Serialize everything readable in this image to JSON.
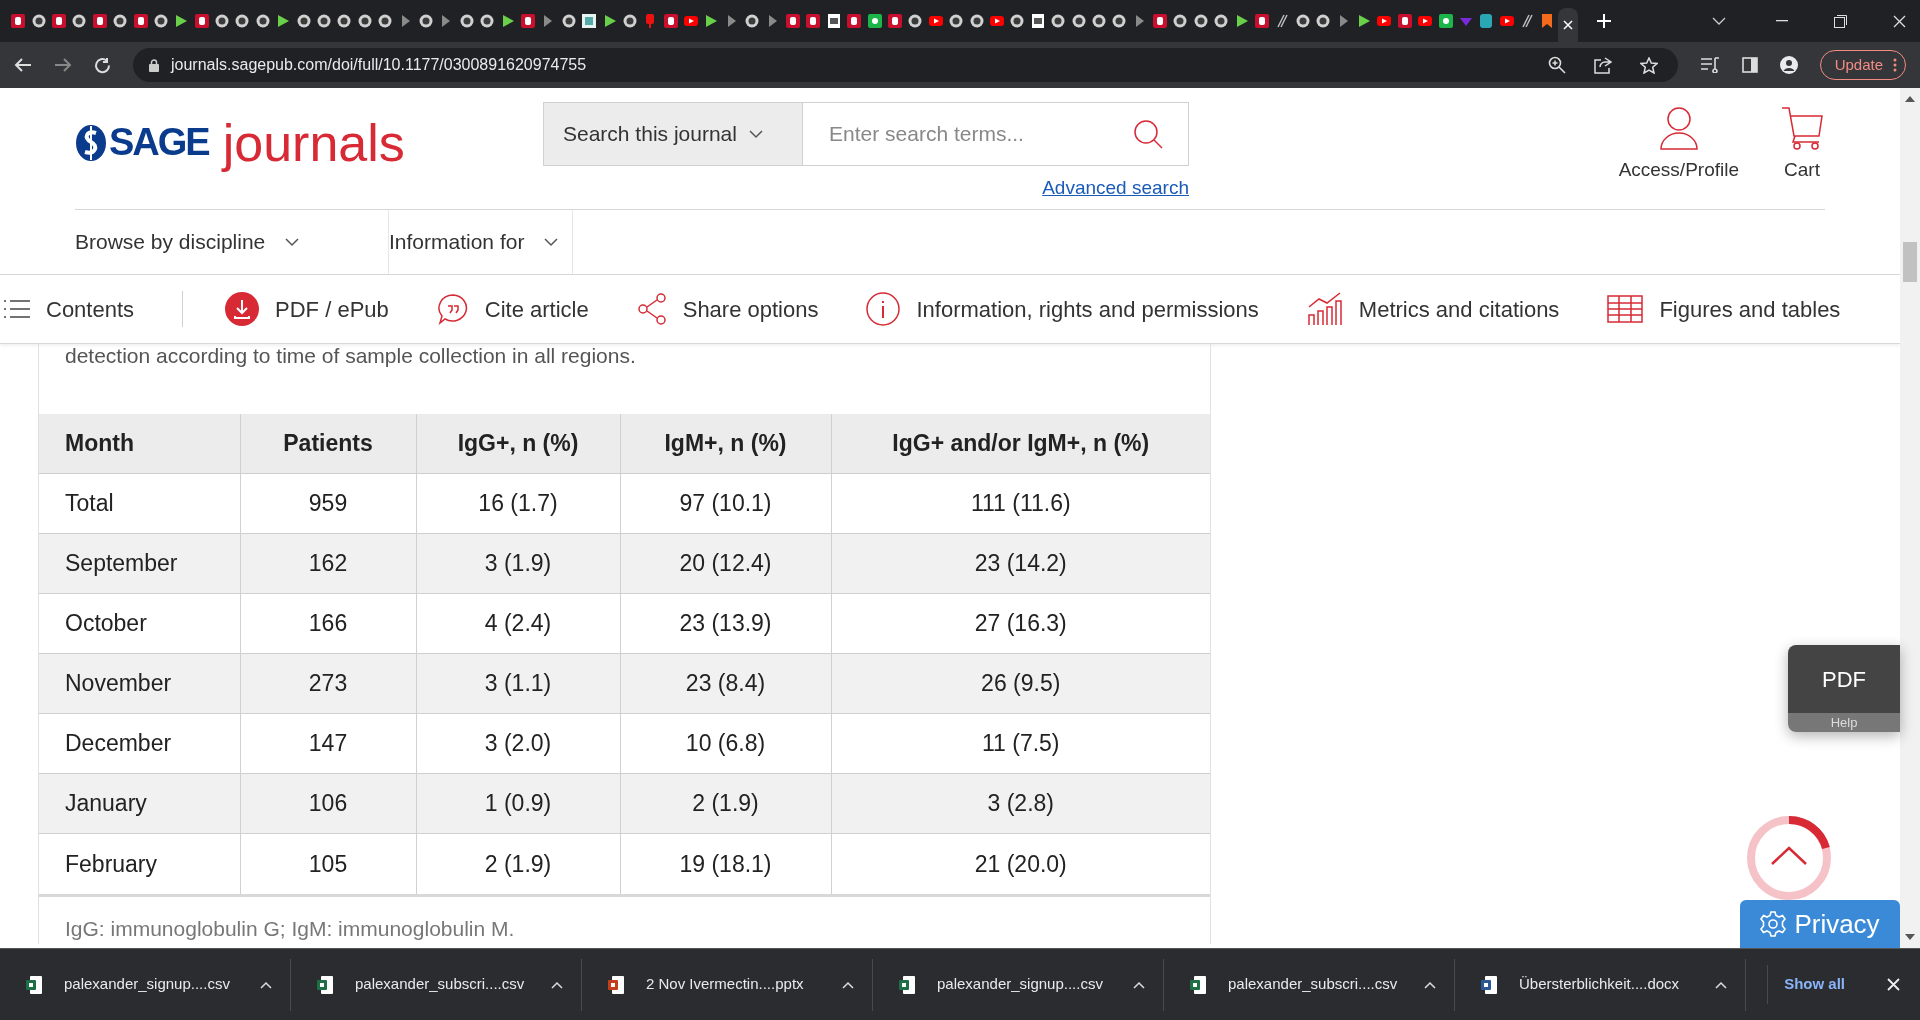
{
  "browser": {
    "tabs": [
      {
        "kind": "b",
        "selected": false
      },
      {
        "kind": "circle",
        "selected": false
      },
      {
        "kind": "b",
        "selected": false
      },
      {
        "kind": "circle",
        "selected": false
      },
      {
        "kind": "b",
        "selected": false
      },
      {
        "kind": "circle",
        "selected": false
      },
      {
        "kind": "b",
        "selected": false
      },
      {
        "kind": "circle",
        "selected": false
      },
      {
        "kind": "play",
        "selected": false
      },
      {
        "kind": "b",
        "selected": false
      },
      {
        "kind": "circle",
        "selected": false
      },
      {
        "kind": "circle",
        "selected": false
      },
      {
        "kind": "circle",
        "selected": false
      },
      {
        "kind": "play",
        "selected": false
      },
      {
        "kind": "circle",
        "selected": false
      },
      {
        "kind": "circle",
        "selected": false
      },
      {
        "kind": "circle",
        "selected": false
      },
      {
        "kind": "circle",
        "selected": false
      },
      {
        "kind": "circle",
        "selected": false
      },
      {
        "kind": "arrow",
        "selected": false
      },
      {
        "kind": "circle",
        "selected": false
      },
      {
        "kind": "arrow",
        "selected": false
      },
      {
        "kind": "circle",
        "selected": false
      },
      {
        "kind": "circle",
        "selected": false
      },
      {
        "kind": "play",
        "selected": false
      },
      {
        "kind": "b",
        "selected": false
      },
      {
        "kind": "arrow",
        "selected": false
      },
      {
        "kind": "circle",
        "selected": false
      },
      {
        "kind": "grid",
        "selected": false
      },
      {
        "kind": "play",
        "selected": false
      },
      {
        "kind": "circle",
        "selected": false
      },
      {
        "kind": "pin",
        "selected": false
      },
      {
        "kind": "b",
        "selected": false
      },
      {
        "kind": "yt",
        "selected": false
      },
      {
        "kind": "play",
        "selected": false
      },
      {
        "kind": "arrow",
        "selected": false
      },
      {
        "kind": "circle",
        "selected": false
      },
      {
        "kind": "arrow",
        "selected": false
      },
      {
        "kind": "b",
        "selected": false
      },
      {
        "kind": "b",
        "selected": false
      },
      {
        "kind": "doc",
        "selected": false
      },
      {
        "kind": "b",
        "selected": false
      },
      {
        "kind": "g",
        "selected": false
      },
      {
        "kind": "b",
        "selected": false
      },
      {
        "kind": "circle",
        "selected": false
      },
      {
        "kind": "yt",
        "selected": false
      },
      {
        "kind": "circle",
        "selected": false
      },
      {
        "kind": "circle",
        "selected": false
      },
      {
        "kind": "yt",
        "selected": false
      },
      {
        "kind": "circle",
        "selected": false
      },
      {
        "kind": "doc",
        "selected": false
      },
      {
        "kind": "circle",
        "selected": false
      },
      {
        "kind": "circle",
        "selected": false
      },
      {
        "kind": "circle",
        "selected": false
      },
      {
        "kind": "circle",
        "selected": false
      },
      {
        "kind": "arrow",
        "selected": false
      },
      {
        "kind": "b",
        "selected": false
      },
      {
        "kind": "circle",
        "selected": false
      },
      {
        "kind": "circle",
        "selected": false
      },
      {
        "kind": "circle",
        "selected": false
      },
      {
        "kind": "play",
        "selected": false
      },
      {
        "kind": "b",
        "selected": false
      },
      {
        "kind": "slash",
        "selected": false
      },
      {
        "kind": "circle",
        "selected": false
      },
      {
        "kind": "circle",
        "selected": false
      },
      {
        "kind": "arrow",
        "selected": false
      },
      {
        "kind": "play",
        "selected": false
      },
      {
        "kind": "yt",
        "selected": false
      },
      {
        "kind": "b",
        "selected": false
      },
      {
        "kind": "yt",
        "selected": false
      },
      {
        "kind": "g",
        "selected": false
      },
      {
        "kind": "purple",
        "selected": false
      },
      {
        "kind": "teal",
        "selected": false
      },
      {
        "kind": "yt",
        "selected": false
      },
      {
        "kind": "slash",
        "selected": false
      },
      {
        "kind": "bookmark",
        "selected": false
      },
      {
        "selected": true
      }
    ],
    "url": "journals.sagepub.com/doi/full/10.1177/0300891620974755",
    "update_button": "Update"
  },
  "header": {
    "logo_sage": "SAGE",
    "logo_journals": "journals",
    "search_scope": "Search this journal",
    "search": {
      "placeholder": "Enter search terms..."
    },
    "advanced_search": "Advanced search",
    "account": "Access/Profile",
    "cart": "Cart"
  },
  "nav": [
    "Browse by discipline",
    "Information for"
  ],
  "toolbar": [
    {
      "kind": "contents",
      "label": "Contents"
    },
    {
      "kind": "pdf",
      "label": "PDF / ePub"
    },
    {
      "kind": "cite",
      "label": "Cite article"
    },
    {
      "kind": "share",
      "label": "Share options"
    },
    {
      "kind": "info",
      "label": "Information, rights and permissions"
    },
    {
      "kind": "metrics",
      "label": "Metrics and citations"
    },
    {
      "kind": "figures",
      "label": "Figures and tables"
    }
  ],
  "table": {
    "caption": "detection according to time of sample collection in all regions.",
    "columns": [
      "Month",
      "Patients",
      "IgG+, n (%)",
      "IgM+, n (%)",
      "IgG+ and/or IgM+, n (%)"
    ],
    "rows": [
      [
        "Total",
        "959",
        "16 (1.7)",
        "97 (10.1)",
        "111 (11.6)"
      ],
      [
        "September",
        "162",
        "3 (1.9)",
        "20 (12.4)",
        "23 (14.2)"
      ],
      [
        "October",
        "166",
        "4 (2.4)",
        "23 (13.9)",
        "27 (16.3)"
      ],
      [
        "November",
        "273",
        "3 (1.1)",
        "23 (8.4)",
        "26 (9.5)"
      ],
      [
        "December",
        "147",
        "3 (2.0)",
        "10 (6.8)",
        "11 (7.5)"
      ],
      [
        "January",
        "106",
        "1 (0.9)",
        "2 (1.9)",
        "3 (2.8)"
      ],
      [
        "February",
        "105",
        "2 (1.9)",
        "19 (18.1)",
        "21 (20.0)"
      ]
    ],
    "footnote": "IgG: immunoglobulin G; IgM: immunoglobulin M."
  },
  "pdf_widget": {
    "label": "PDF",
    "help": "Help"
  },
  "privacy_button": "Privacy",
  "downloads": [
    {
      "kind": "xlsx",
      "name": "palexander_signup....csv"
    },
    {
      "kind": "xlsx",
      "name": "palexander_subscri....csv"
    },
    {
      "kind": "pptx",
      "name": "2 Nov Ivermectin....pptx"
    },
    {
      "kind": "xlsx",
      "name": "palexander_signup....csv"
    },
    {
      "kind": "xlsx",
      "name": "palexander_subscri....csv"
    },
    {
      "kind": "docx",
      "name": "Übersterblichkeit....docx"
    }
  ],
  "show_all": "Show all"
}
